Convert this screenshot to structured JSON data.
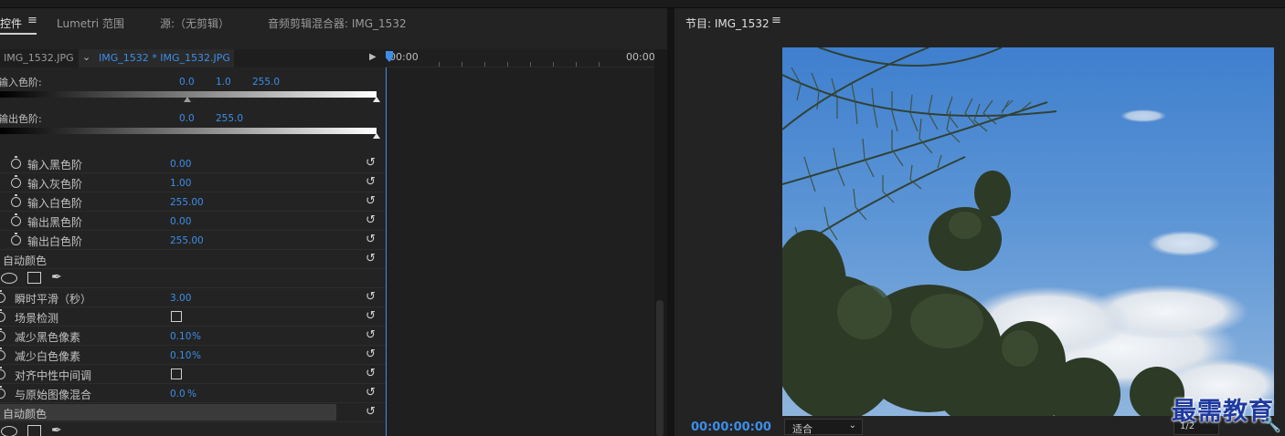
{
  "tabs": [
    {
      "label": "控件",
      "active": true
    },
    {
      "label": "Lumetri 范围"
    },
    {
      "label": "源:（无剪辑）"
    },
    {
      "label": "音频剪辑混合器: IMG_1532"
    }
  ],
  "clip": {
    "master": "IMG_1532.JPG",
    "sequence": "IMG_1532 * IMG_1532.JPG"
  },
  "levels": {
    "input_label": "输入色阶:",
    "input_values": [
      "0.0",
      "1.0",
      "255.0"
    ],
    "output_label": "输出色阶:",
    "output_values": [
      "0.0",
      "255.0"
    ]
  },
  "params": [
    {
      "label": "输入黑色阶",
      "value": "0.00"
    },
    {
      "label": "输入灰色阶",
      "value": "1.00"
    },
    {
      "label": "输入白色阶",
      "value": "255.00"
    },
    {
      "label": "输出黑色阶",
      "value": "0.00"
    },
    {
      "label": "输出白色阶",
      "value": "255.00"
    }
  ],
  "auto_color_1": {
    "title": "自动颜色",
    "params": [
      {
        "label": "瞬时平滑（秒）",
        "value": "3.00"
      },
      {
        "label": "场景检测",
        "checkbox": true
      },
      {
        "label": "减少黑色像素",
        "value": "0.10",
        "unit": "%"
      },
      {
        "label": "减少白色像素",
        "value": "0.10",
        "unit": "%"
      },
      {
        "label": "对齐中性中间调",
        "checkbox": true
      },
      {
        "label": "与原始图像混合",
        "value": "0.0",
        "unit": "%"
      }
    ]
  },
  "auto_color_2": {
    "title": "自动颜色"
  },
  "timeline": {
    "start": "00:00",
    "end": "00:00"
  },
  "program": {
    "title": "节目: IMG_1532",
    "timecode": "00:00:00:00",
    "fit": "适合",
    "resolution": "1/2",
    "watermark": "最需教育"
  },
  "colors": {
    "accent": "#3d8ee8",
    "panel": "#232323"
  },
  "icons": [
    "hamburger-menu-icon",
    "chevron-down-icon",
    "play-triangle-icon",
    "stopwatch-icon",
    "reset-icon",
    "ellipse-mask-icon",
    "rectangle-mask-icon",
    "pen-mask-icon",
    "wrench-icon"
  ]
}
